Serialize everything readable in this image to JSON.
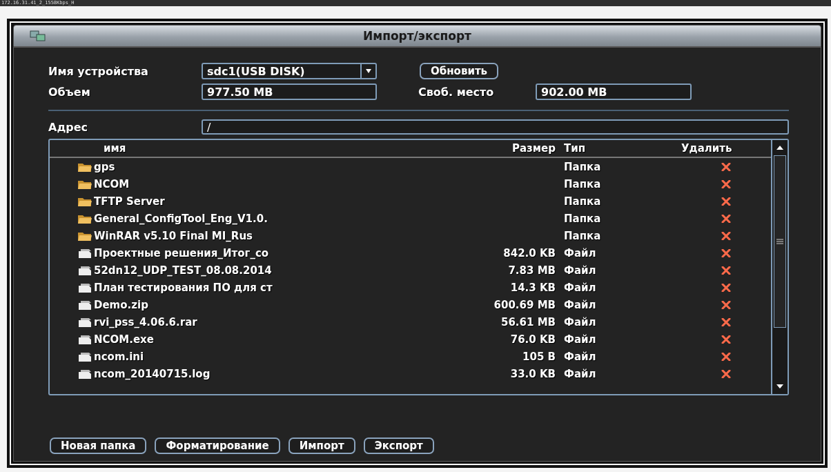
{
  "stream_label": "172.16.31.41_2_1558Kbps_H",
  "window": {
    "title": "Импорт/экспорт"
  },
  "device": {
    "label": "Имя устройства",
    "value": "sdc1(USB DISK)"
  },
  "refresh_button": "Обновить",
  "volume": {
    "label": "Объем",
    "value": "977.50 MB"
  },
  "free_space": {
    "label": "Своб. место",
    "value": "902.00 MB"
  },
  "address": {
    "label": "Адрес",
    "value": "/"
  },
  "table": {
    "columns": [
      "имя",
      "Размер",
      "Тип",
      "Удалить"
    ],
    "rows": [
      {
        "kind": "folder",
        "name": "gps",
        "size": "",
        "type": "Папка"
      },
      {
        "kind": "folder",
        "name": "NCOM",
        "size": "",
        "type": "Папка"
      },
      {
        "kind": "folder",
        "name": "TFTP Server",
        "size": "",
        "type": "Папка"
      },
      {
        "kind": "folder",
        "name": "General_ConfigTool_Eng_V1.0.",
        "size": "",
        "type": "Папка"
      },
      {
        "kind": "folder",
        "name": "WinRAR v5.10 Final MI_Rus",
        "size": "",
        "type": "Папка"
      },
      {
        "kind": "file",
        "name": "Проектные решения_Итог_со",
        "size": "842.0 KB",
        "type": "Файл"
      },
      {
        "kind": "file",
        "name": "52dn12_UDP_TEST_08.08.2014",
        "size": "7.83 MB",
        "type": "Файл"
      },
      {
        "kind": "file",
        "name": "План тестирования ПО для ст",
        "size": "14.3 KB",
        "type": "Файл"
      },
      {
        "kind": "file",
        "name": "Demo.zip",
        "size": "600.69 MB",
        "type": "Файл"
      },
      {
        "kind": "file",
        "name": "rvi_pss_4.06.6.rar",
        "size": "56.61 MB",
        "type": "Файл"
      },
      {
        "kind": "file",
        "name": "NCOM.exe",
        "size": "76.0 KB",
        "type": "Файл"
      },
      {
        "kind": "file",
        "name": "ncom.ini",
        "size": "105 B",
        "type": "Файл"
      },
      {
        "kind": "file",
        "name": "ncom_20140715.log",
        "size": "33.0 KB",
        "type": "Файл"
      }
    ]
  },
  "buttons": [
    "Новая папка",
    "Форматирование",
    "Импорт",
    "Экспорт"
  ]
}
